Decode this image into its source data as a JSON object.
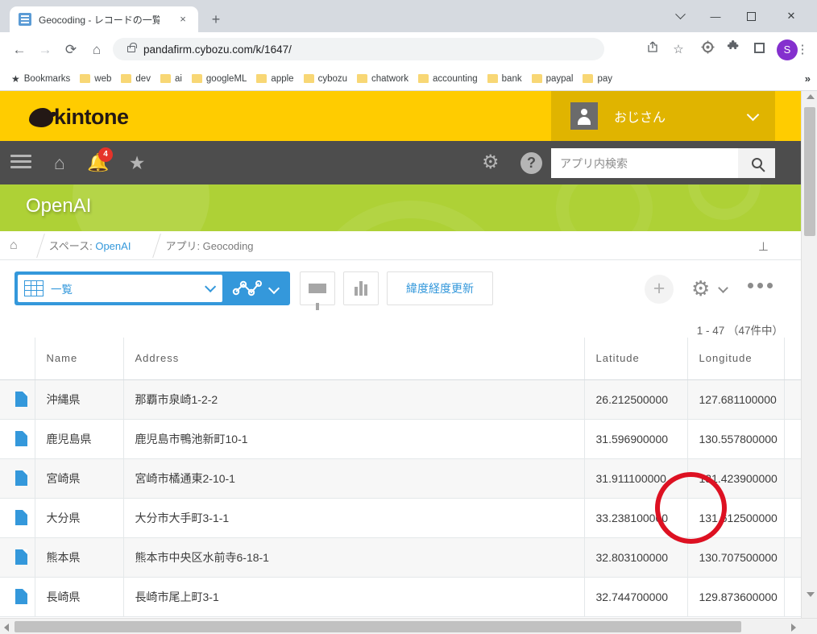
{
  "browser": {
    "tab": {
      "title": "Geocoding - レコードの一覧",
      "favicon_icon": "list-favicon",
      "close_icon": "×"
    },
    "new_tab_label": "+",
    "window_controls": {
      "tab_search": "tab-search-icon",
      "minimize": "—",
      "maximize": "□",
      "close": "✕"
    },
    "nav": {
      "back": "←",
      "forward": "→",
      "reload": "⟳",
      "home": "⌂"
    },
    "omnibox": {
      "url": "pandafirm.cybozu.com/k/1647/",
      "lock_icon": "lock-icon"
    },
    "actions": {
      "share": "⇪",
      "bookmark_star": "☆",
      "extension": "⚙",
      "puzzle": "🧩",
      "side_panel": "□",
      "profile_initial": "S",
      "menu": "⋮"
    },
    "bookmarks": {
      "star_label": "Bookmarks",
      "items": [
        "web",
        "dev",
        "ai",
        "googleML",
        "apple",
        "cybozu",
        "chatwork",
        "accounting",
        "bank",
        "paypal",
        "pay"
      ],
      "overflow": "»"
    }
  },
  "kintone": {
    "logo_text": "kintone",
    "user": {
      "name": "おじさん",
      "avatar_icon": "user-avatar-icon",
      "chevron": "chevron-down-icon"
    },
    "nav": {
      "menu_icon": "hamburger-icon",
      "home_icon": "⌂",
      "notification_icon": "bell-icon",
      "notification_count": "4",
      "favorite_icon": "★",
      "settings_icon": "⚙",
      "help_icon": "?",
      "search_placeholder": "アプリ内検索",
      "search_value": "",
      "search_button_icon": "search-icon"
    },
    "banner": {
      "title": "OpenAI"
    },
    "breadcrumb": {
      "home_icon": "⌂",
      "space_prefix": "スペース: ",
      "space_name": "OpenAI",
      "app": "アプリ: Geocoding",
      "pin_icon": "pin-icon"
    },
    "toolbar": {
      "view_name": "一覧",
      "view_icon": "table-grid-icon",
      "graph_icon": "graph-icon",
      "filter_icon": "funnel-icon",
      "chart_icon": "bar-chart-icon",
      "custom_button": "緯度経度更新",
      "add_icon": "+",
      "settings_icon": "⚙",
      "more_icon": "more-dots-icon"
    },
    "record_count": "1 - 47 （47件中）",
    "table": {
      "columns": [
        "Name",
        "Address",
        "Latitude",
        "Longitude"
      ],
      "rows": [
        {
          "name": "沖縄県",
          "address": "那覇市泉崎1-2-2",
          "lat": "26.212500000",
          "lng": "127.681100000"
        },
        {
          "name": "鹿児島県",
          "address": "鹿児島市鴨池新町10-1",
          "lat": "31.596900000",
          "lng": "130.557800000"
        },
        {
          "name": "宮崎県",
          "address": "宮崎市橘通東2-10-1",
          "lat": "31.911100000",
          "lng": "131.423900000"
        },
        {
          "name": "大分県",
          "address": "大分市大手町3-1-1",
          "lat": "33.238100000",
          "lng": "131.612500000"
        },
        {
          "name": "熊本県",
          "address": "熊本市中央区水前寺6-18-1",
          "lat": "32.803100000",
          "lng": "130.707500000"
        },
        {
          "name": "長崎県",
          "address": "長崎市尾上町3-1",
          "lat": "32.744700000",
          "lng": "129.873600000"
        }
      ]
    }
  },
  "annotation": {
    "shape": "circle",
    "color": "#dd1122"
  },
  "colors": {
    "kintone_yellow": "#ffcc00",
    "kintone_yellow_dark": "#e0b400",
    "kintone_nav_gray": "#4d4d4d",
    "banner_green": "#aed136",
    "accent_blue": "#3498db",
    "annotation_red": "#dd1122",
    "profile_purple": "#8430ce"
  }
}
